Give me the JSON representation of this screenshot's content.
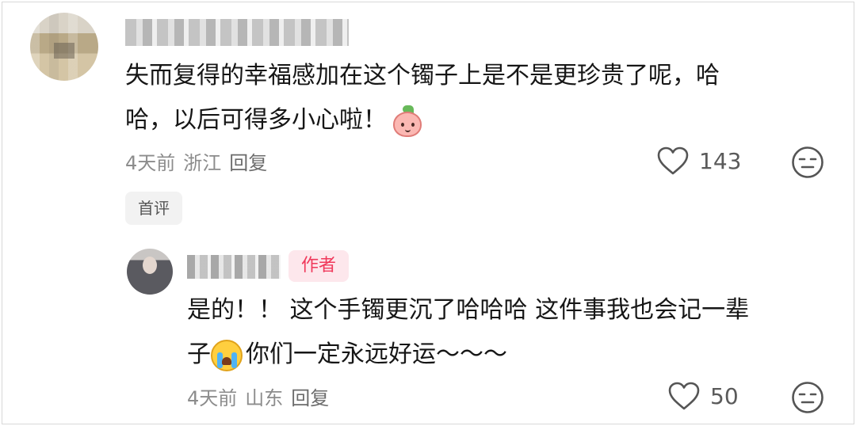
{
  "comments": [
    {
      "text_line1": "失而复得的幸福感加在这个镯子上是不是更珍贵了呢，哈",
      "text_line2": "哈，以后可得多小心啦！",
      "emoji": "peach-face-emoji",
      "time": "4天前",
      "location": "浙江",
      "reply_label": "回复",
      "likes": "143",
      "badge": "首评"
    },
    {
      "author_tag": "作者",
      "text_line1": "是的！！ 这个手镯更沉了哈哈哈 这件事我也会记一辈",
      "text_line2_prefix": "子",
      "emoji": "loudly-crying-face-emoji",
      "text_line2_suffix": "你们一定永远好运～～～",
      "time": "4天前",
      "location": "山东",
      "reply_label": "回复",
      "likes": "50"
    }
  ],
  "icons": {
    "like": "heart-outline-icon",
    "dislike": "neutral-face-icon"
  },
  "colors": {
    "author_tag_text": "#f0395b",
    "author_tag_bg": "#fde7ec",
    "meta_text": "#8c8c8c"
  }
}
